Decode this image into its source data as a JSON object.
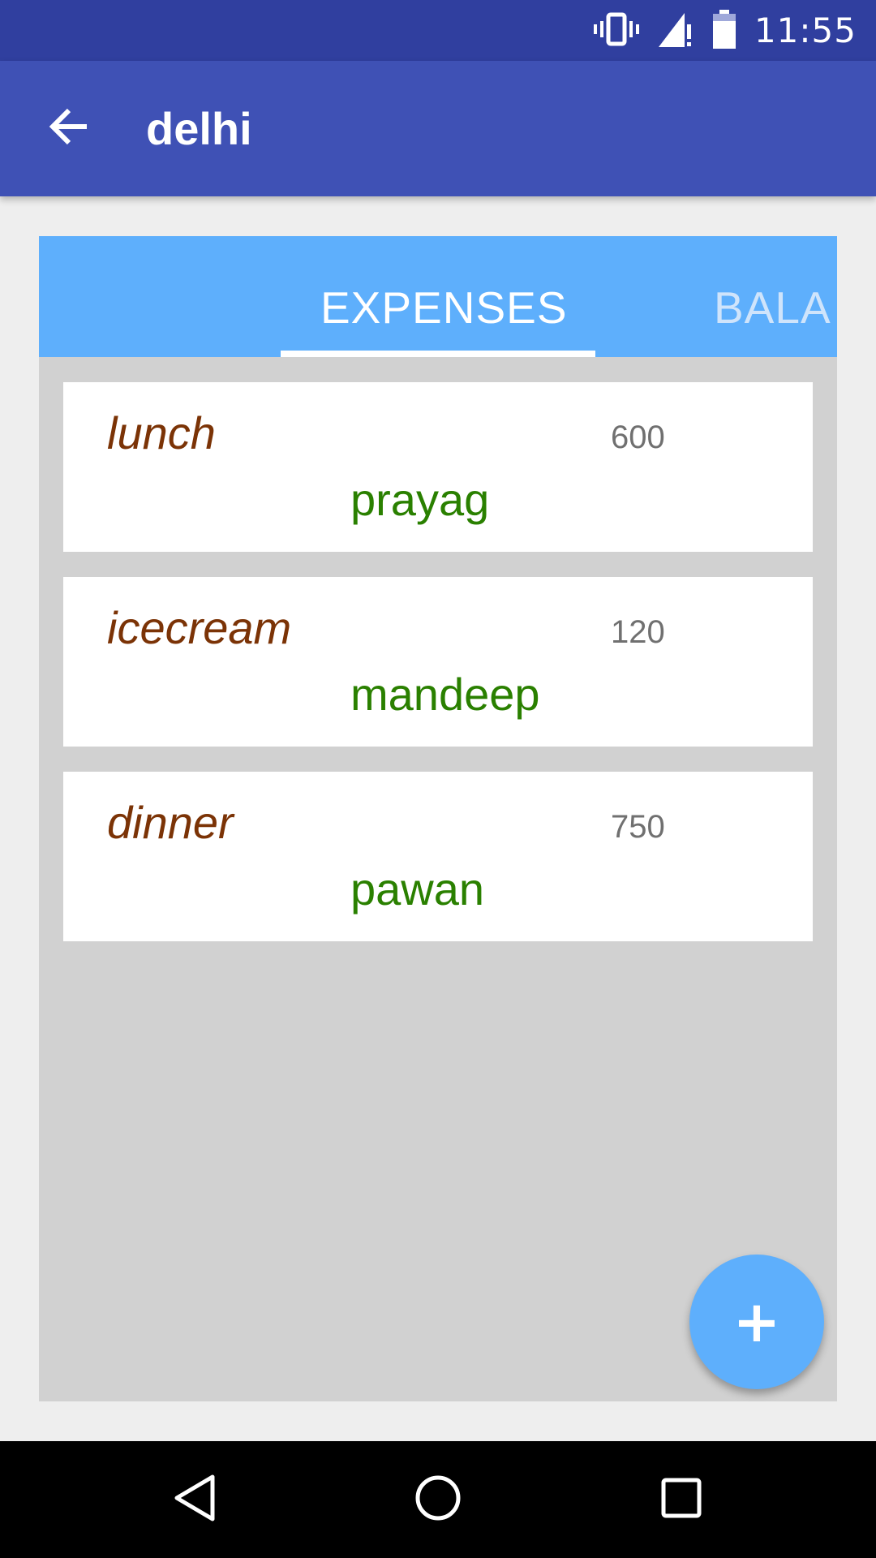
{
  "status_bar": {
    "time": "11:55",
    "icons": [
      "vibrate-icon",
      "signal-icon",
      "battery-icon"
    ]
  },
  "app_bar": {
    "title": "delhi",
    "back_icon": "arrow-back-icon",
    "color": "#3f51b5"
  },
  "tabs": [
    {
      "label": "EXPENSES",
      "selected": true
    },
    {
      "label": "BALA",
      "selected": false
    }
  ],
  "expenses": [
    {
      "name": "lunch",
      "amount": "600",
      "person": "prayag"
    },
    {
      "name": "icecream",
      "amount": "120",
      "person": "mandeep"
    },
    {
      "name": "dinner",
      "amount": "750",
      "person": "pawan"
    }
  ],
  "fab": {
    "label": "+",
    "icon": "add-icon",
    "color": "#5eaffc"
  },
  "nav_bar": {
    "icons": [
      "back-triangle-icon",
      "home-circle-icon",
      "recents-square-icon"
    ]
  },
  "colors": {
    "status_bar": "#303f9f",
    "tab_strip": "#5eaffc",
    "item_name": "#7b3306",
    "item_person": "#2a8000",
    "item_amount": "#707070"
  }
}
